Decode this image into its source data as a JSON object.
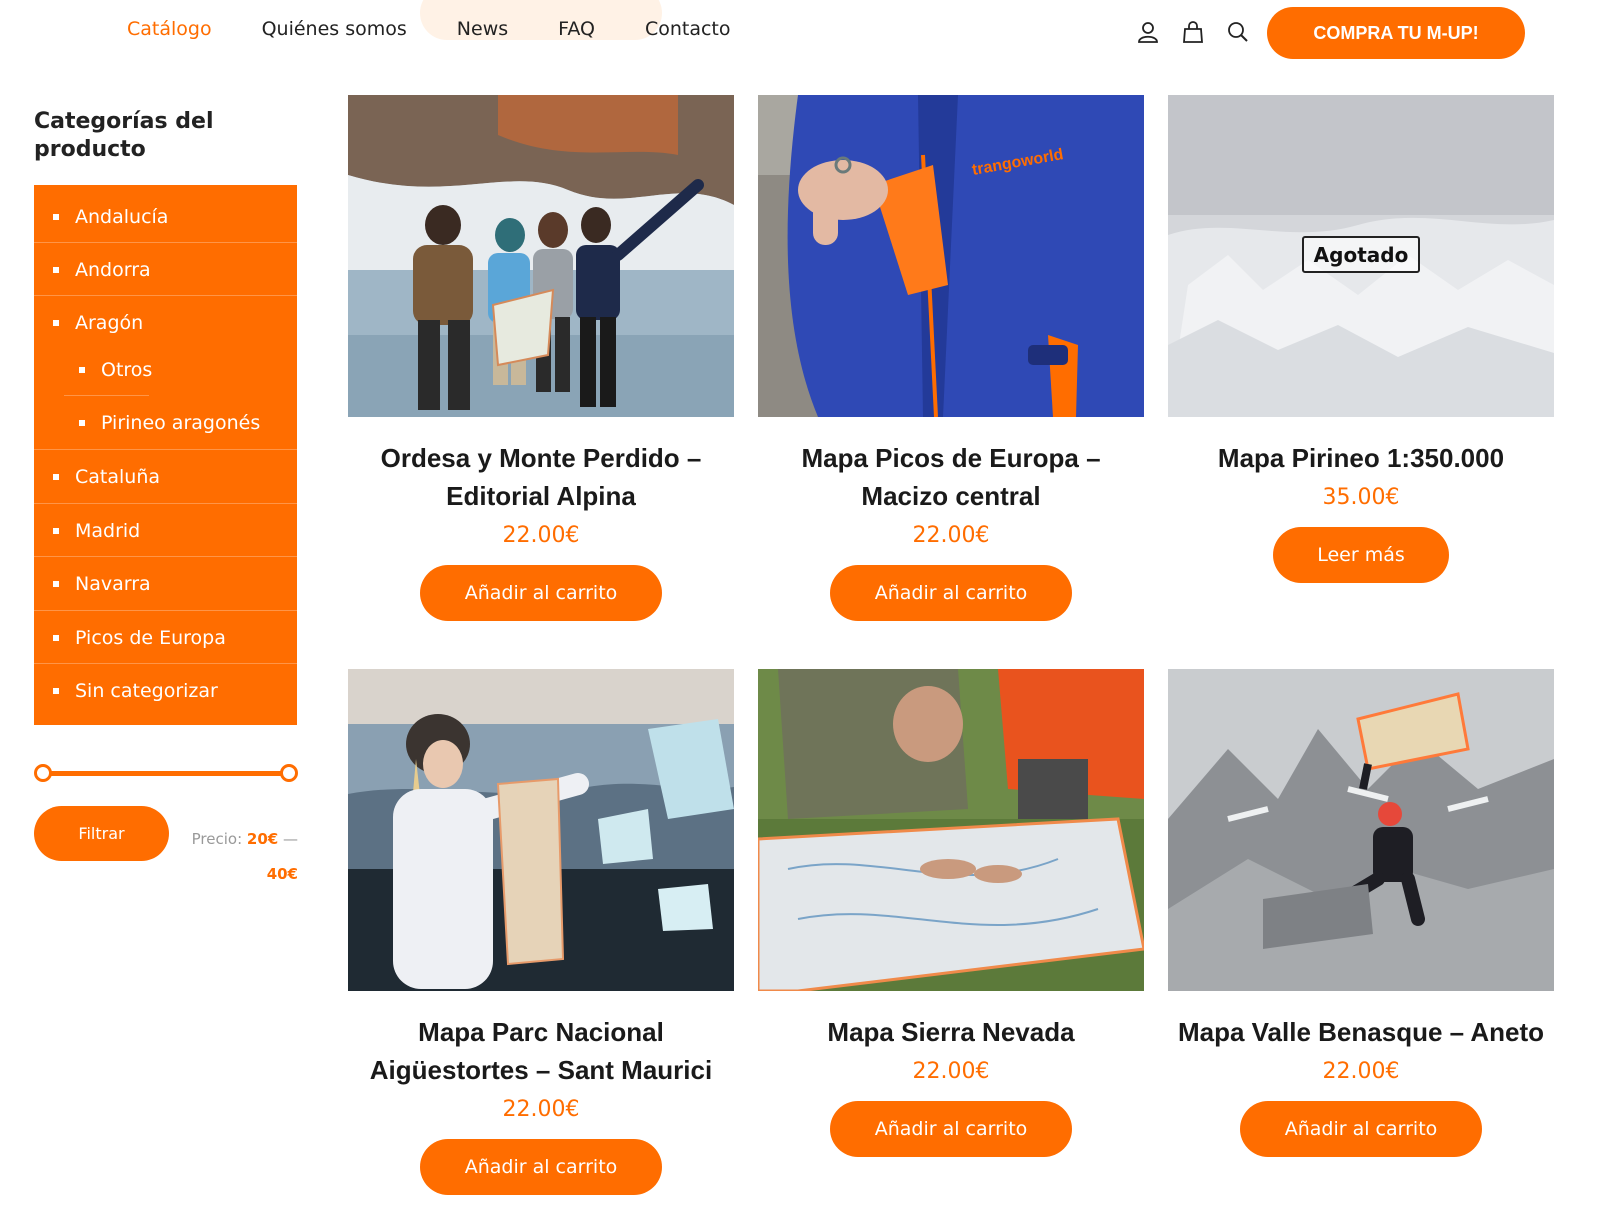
{
  "nav": {
    "items": [
      {
        "label": "Catálogo",
        "active": true
      },
      {
        "label": "Quiénes somos",
        "active": false
      },
      {
        "label": "News",
        "active": false
      },
      {
        "label": "FAQ",
        "active": false
      },
      {
        "label": "Contacto",
        "active": false
      }
    ],
    "icons": [
      "user-icon",
      "cart-icon",
      "search-icon"
    ],
    "cta_label": "COMPRA TU M-UP!"
  },
  "sidebar": {
    "title": "Categorías del producto",
    "categories": [
      {
        "label": "Andalucía",
        "level": 0
      },
      {
        "label": "Andorra",
        "level": 0
      },
      {
        "label": "Aragón",
        "level": 0
      },
      {
        "label": "Otros",
        "level": 1
      },
      {
        "label": "Pirineo aragonés",
        "level": 1
      },
      {
        "label": "Cataluña",
        "level": 0
      },
      {
        "label": "Madrid",
        "level": 0
      },
      {
        "label": "Navarra",
        "level": 0
      },
      {
        "label": "Picos de Europa",
        "level": 0
      },
      {
        "label": "Sin categorizar",
        "level": 0
      }
    ],
    "filter": {
      "button_label": "Filtrar",
      "price_label": "Precio:",
      "min_price": "20€",
      "separator": "—",
      "max_price": "40€"
    }
  },
  "products": [
    {
      "title": "Ordesa y Monte Perdido – Editorial Alpina",
      "price": "22.00€",
      "button": "Añadir al carrito",
      "image": "group-on-frozen-lake"
    },
    {
      "title": "Mapa Picos de Europa – Macizo central",
      "price": "22.00€",
      "button": "Añadir al carrito",
      "image": "blue-jacket-pocket-map"
    },
    {
      "title": "Mapa Pirineo 1:350.000",
      "price": "35.00€",
      "button": "Leer más",
      "badge": "Agotado",
      "image": "snowy-mountains-aerial"
    },
    {
      "title": "Mapa Parc Nacional Aigüestortes – Sant Maurici",
      "price": "22.00€",
      "button": "Añadir al carrito",
      "image": "woman-on-icy-beach"
    },
    {
      "title": "Mapa Sierra Nevada",
      "price": "22.00€",
      "button": "Añadir al carrito",
      "image": "people-reading-map-on-grass"
    },
    {
      "title": "Mapa Valle Benasque – Aneto",
      "price": "22.00€",
      "button": "Añadir al carrito",
      "image": "climber-on-summit"
    }
  ],
  "colors": {
    "accent": "#ff6d00",
    "text": "#1e1e1e",
    "white": "#ffffff"
  }
}
